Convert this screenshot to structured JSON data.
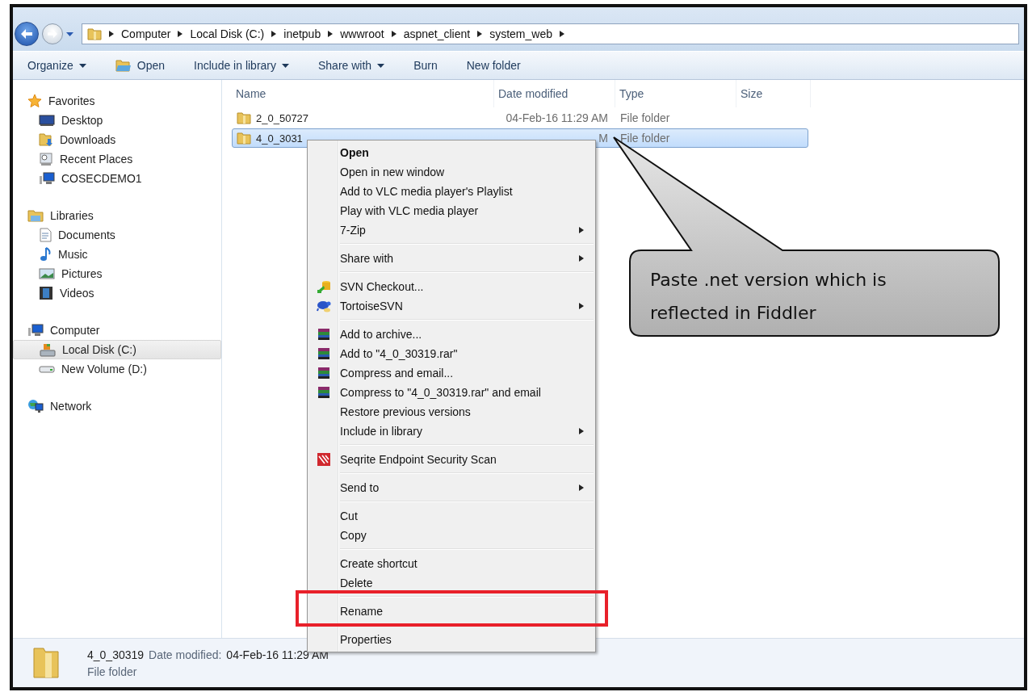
{
  "address_bar": {
    "segments": [
      "Computer",
      "Local Disk (C:)",
      "inetpub",
      "wwwroot",
      "aspnet_client",
      "system_web"
    ]
  },
  "toolbar": [
    {
      "label": "Organize",
      "kind": "menu"
    },
    {
      "label": "Open",
      "kind": "icon"
    },
    {
      "label": "Include in library",
      "kind": "menu"
    },
    {
      "label": "Share with",
      "kind": "menu"
    },
    {
      "label": "Burn",
      "kind": "plain"
    },
    {
      "label": "New folder",
      "kind": "plain"
    }
  ],
  "sidebar": {
    "groups": [
      {
        "label": "Favorites",
        "kind": "star",
        "children": [
          {
            "label": "Desktop",
            "kind": "desktop",
            "selected": false
          },
          {
            "label": "Downloads",
            "kind": "downloads",
            "selected": false
          },
          {
            "label": "Recent Places",
            "kind": "recent",
            "selected": false
          },
          {
            "label": "COSECDEMO1",
            "kind": "computer",
            "selected": false
          }
        ]
      },
      {
        "label": "Libraries",
        "kind": "libraries",
        "children": [
          {
            "label": "Documents",
            "kind": "documents",
            "selected": false
          },
          {
            "label": "Music",
            "kind": "music",
            "selected": false
          },
          {
            "label": "Pictures",
            "kind": "pictures",
            "selected": false
          },
          {
            "label": "Videos",
            "kind": "videos",
            "selected": false
          }
        ]
      },
      {
        "label": "Computer",
        "kind": "computer",
        "children": [
          {
            "label": "Local Disk (C:)",
            "kind": "drive",
            "selected": true
          },
          {
            "label": "New Volume (D:)",
            "kind": "volume",
            "selected": false
          }
        ]
      },
      {
        "label": "Network",
        "kind": "network"
      }
    ]
  },
  "file_list": {
    "columns": [
      "Name",
      "Date modified",
      "Type",
      "Size"
    ],
    "rows": [
      {
        "name": "2_0_50727",
        "date": "04-Feb-16 11:29 AM",
        "type": "File folder",
        "selected": false
      },
      {
        "name": "4_0_3031",
        "date": "M",
        "type": "File folder",
        "selected": true
      }
    ]
  },
  "context_menu": {
    "sections": [
      [
        {
          "label": "Open",
          "kind": "plain",
          "default": true,
          "submenu": false
        },
        {
          "label": "Open in new window",
          "kind": "plain",
          "default": false,
          "submenu": false
        },
        {
          "label": "Add to VLC media player's Playlist",
          "kind": "plain",
          "default": false,
          "submenu": false
        },
        {
          "label": "Play with VLC media player",
          "kind": "plain",
          "default": false,
          "submenu": false
        },
        {
          "label": "7-Zip",
          "kind": "plain",
          "default": false,
          "submenu": true
        }
      ],
      [
        {
          "label": "Share with",
          "kind": "plain",
          "default": false,
          "submenu": true
        }
      ],
      [
        {
          "label": "SVN Checkout...",
          "kind": "svn",
          "default": false,
          "submenu": false
        },
        {
          "label": "TortoiseSVN",
          "kind": "tortoise",
          "default": false,
          "submenu": true
        }
      ],
      [
        {
          "label": "Add to archive...",
          "kind": "archive",
          "default": false,
          "submenu": false
        },
        {
          "label": "Add to \"4_0_30319.rar\"",
          "kind": "archive",
          "default": false,
          "submenu": false
        },
        {
          "label": "Compress and email...",
          "kind": "archive",
          "default": false,
          "submenu": false
        },
        {
          "label": "Compress to \"4_0_30319.rar\" and email",
          "kind": "archive",
          "default": false,
          "submenu": false
        },
        {
          "label": "Restore previous versions",
          "kind": "plain",
          "default": false,
          "submenu": false
        },
        {
          "label": "Include in library",
          "kind": "plain",
          "default": false,
          "submenu": true
        }
      ],
      [
        {
          "label": "Seqrite Endpoint Security Scan",
          "kind": "scan",
          "default": false,
          "submenu": false
        }
      ],
      [
        {
          "label": "Send to",
          "kind": "plain",
          "default": false,
          "submenu": true
        }
      ],
      [
        {
          "label": "Cut",
          "kind": "plain",
          "default": false,
          "submenu": false
        },
        {
          "label": "Copy",
          "kind": "plain",
          "default": false,
          "submenu": false
        }
      ],
      [
        {
          "label": "Create shortcut",
          "kind": "plain",
          "default": false,
          "submenu": false
        },
        {
          "label": "Delete",
          "kind": "plain",
          "default": false,
          "submenu": false
        }
      ],
      [
        {
          "label": "Rename",
          "kind": "plain",
          "default": false,
          "submenu": false,
          "highlighted": true
        }
      ],
      [
        {
          "label": "Properties",
          "kind": "plain",
          "default": false,
          "submenu": false
        }
      ]
    ]
  },
  "callout": {
    "text": "Paste .net version which is reflected in Fiddler"
  },
  "details_pane": {
    "name": "4_0_30319",
    "date_label": "Date modified:",
    "date": "04-Feb-16 11:29 AM",
    "type": "File folder"
  }
}
